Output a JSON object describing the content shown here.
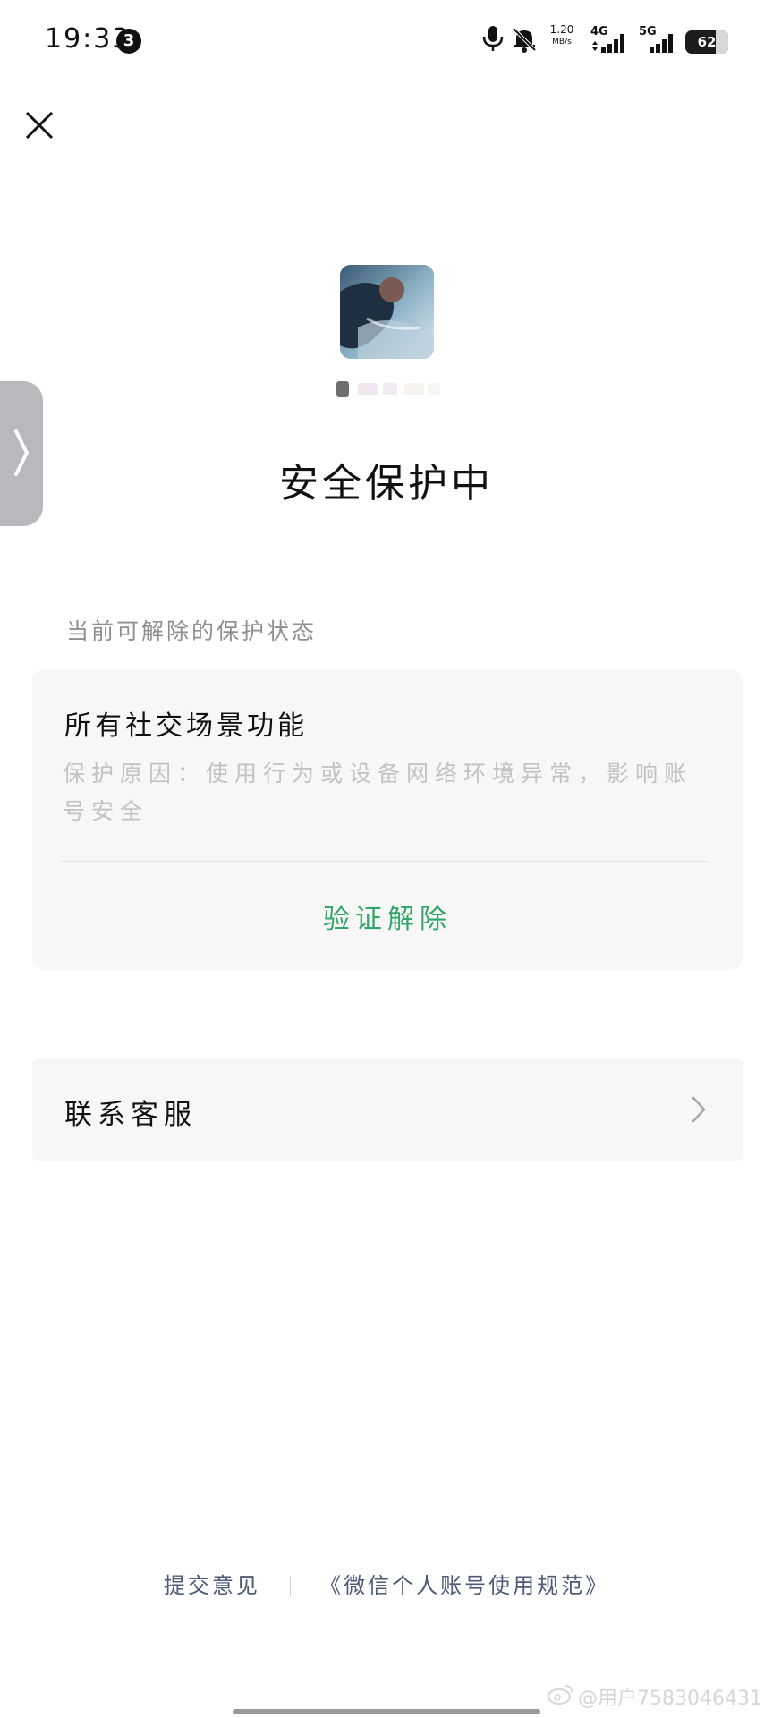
{
  "status_bar": {
    "time": "19:33",
    "notification_count": "3",
    "net_speed_value": "1.20",
    "net_speed_unit": "MB/s",
    "signal_1_label": "4G",
    "signal_2_label": "5G",
    "battery_level": "62"
  },
  "header": {
    "close_icon": "close-icon"
  },
  "profile": {
    "avatar_colors": [
      "#2c4a63",
      "#6f97b0",
      "#c9dbe5"
    ]
  },
  "main": {
    "title": "安全保护中",
    "section_label": "当前可解除的保护状态",
    "card": {
      "title": "所有社交场景功能",
      "reason": "保护原因：使用行为或设备网络环境异常，影响账号安全",
      "action_label": "验证解除"
    },
    "contact": {
      "label": "联系客服"
    }
  },
  "footer": {
    "feedback_label": "提交意见",
    "policy_label": "《微信个人账号使用规范》"
  },
  "watermark": {
    "text": "@用户7583046431"
  },
  "colors": {
    "accent_green": "#2fa567",
    "link_blue": "#4d5a78",
    "card_bg": "#f7f7f7",
    "muted_text": "#c2c2c2"
  }
}
